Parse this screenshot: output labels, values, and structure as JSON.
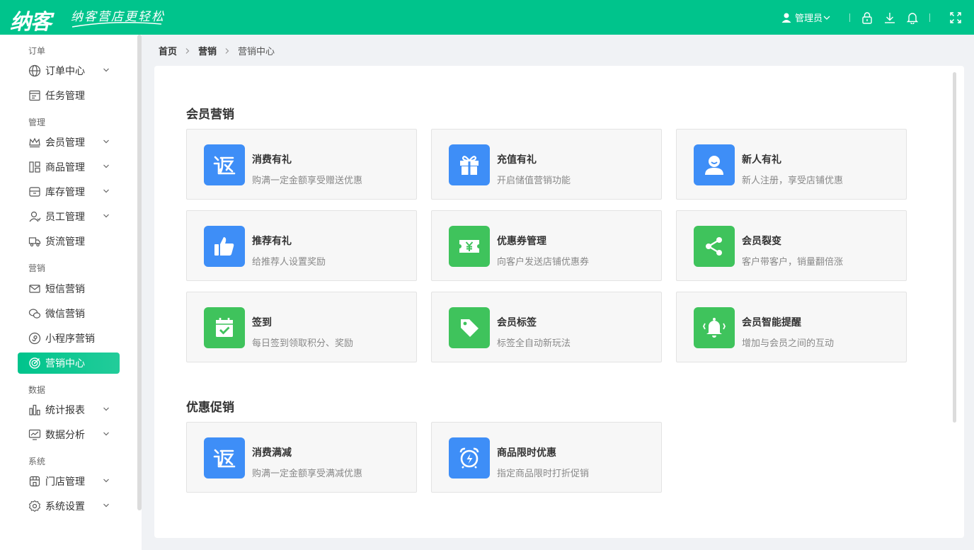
{
  "header": {
    "logo_text": "纳客",
    "slogan": "纳客营店更轻松",
    "user_label": "管理员",
    "brand_color": "#00c48c"
  },
  "sidebar": {
    "groups": [
      {
        "label": "订单",
        "items": [
          {
            "label": "订单中心",
            "icon": "globe-icon",
            "has_children": true
          },
          {
            "label": "任务管理",
            "icon": "task-icon",
            "has_children": false
          }
        ]
      },
      {
        "label": "管理",
        "items": [
          {
            "label": "会员管理",
            "icon": "crown-icon",
            "has_children": true
          },
          {
            "label": "商品管理",
            "icon": "goods-icon",
            "has_children": true
          },
          {
            "label": "库存管理",
            "icon": "inventory-icon",
            "has_children": true
          },
          {
            "label": "员工管理",
            "icon": "staff-icon",
            "has_children": true
          },
          {
            "label": "货流管理",
            "icon": "truck-icon",
            "has_children": false
          }
        ]
      },
      {
        "label": "营销",
        "items": [
          {
            "label": "短信营销",
            "icon": "mail-icon",
            "has_children": false
          },
          {
            "label": "微信营销",
            "icon": "wechat-icon",
            "has_children": false
          },
          {
            "label": "小程序营销",
            "icon": "miniapp-icon",
            "has_children": false
          },
          {
            "label": "营销中心",
            "icon": "target-icon",
            "has_children": false,
            "active": true
          }
        ]
      },
      {
        "label": "数据",
        "items": [
          {
            "label": "统计报表",
            "icon": "bar-chart-icon",
            "has_children": true
          },
          {
            "label": "数据分析",
            "icon": "analysis-icon",
            "has_children": true
          }
        ]
      },
      {
        "label": "系统",
        "items": [
          {
            "label": "门店管理",
            "icon": "store-icon",
            "has_children": true
          },
          {
            "label": "系统设置",
            "icon": "gear-icon",
            "has_children": true
          }
        ]
      }
    ]
  },
  "breadcrumb": [
    "首页",
    "营销",
    "营销中心"
  ],
  "sections": [
    {
      "title": "会员营销",
      "cards": [
        {
          "title": "消费有礼",
          "desc": "购满一定金额享受赠送优惠",
          "icon": "rebate-icon",
          "color": "#3e8ef7"
        },
        {
          "title": "充值有礼",
          "desc": "开启储值营销功能",
          "icon": "gift-icon",
          "color": "#3e8ef7"
        },
        {
          "title": "新人有礼",
          "desc": "新人注册，享受店铺优惠",
          "icon": "new-user-icon",
          "color": "#3e8ef7"
        },
        {
          "title": "推荐有礼",
          "desc": "给推荐人设置奖励",
          "icon": "thumbs-up-icon",
          "color": "#3e8ef7"
        },
        {
          "title": "优惠券管理",
          "desc": "向客户发送店铺优惠券",
          "icon": "coupon-icon",
          "color": "#3fc35c"
        },
        {
          "title": "会员裂变",
          "desc": "客户带客户，销量翻倍涨",
          "icon": "share-icon",
          "color": "#3fc35c"
        },
        {
          "title": "签到",
          "desc": "每日签到领取积分、奖励",
          "icon": "calendar-check-icon",
          "color": "#3fc35c"
        },
        {
          "title": "会员标签",
          "desc": "标签全自动新玩法",
          "icon": "tag-icon",
          "color": "#3fc35c"
        },
        {
          "title": "会员智能提醒",
          "desc": "增加与会员之间的互动",
          "icon": "bell-icon",
          "color": "#3fc35c"
        }
      ]
    },
    {
      "title": "优惠促销",
      "cards": [
        {
          "title": "消费满减",
          "desc": "购满一定金额享受满减优惠",
          "icon": "rebate-icon",
          "color": "#3e8ef7"
        },
        {
          "title": "商品限时优惠",
          "desc": "指定商品限时打折促销",
          "icon": "alarm-clock-icon",
          "color": "#3e8ef7"
        }
      ]
    }
  ]
}
